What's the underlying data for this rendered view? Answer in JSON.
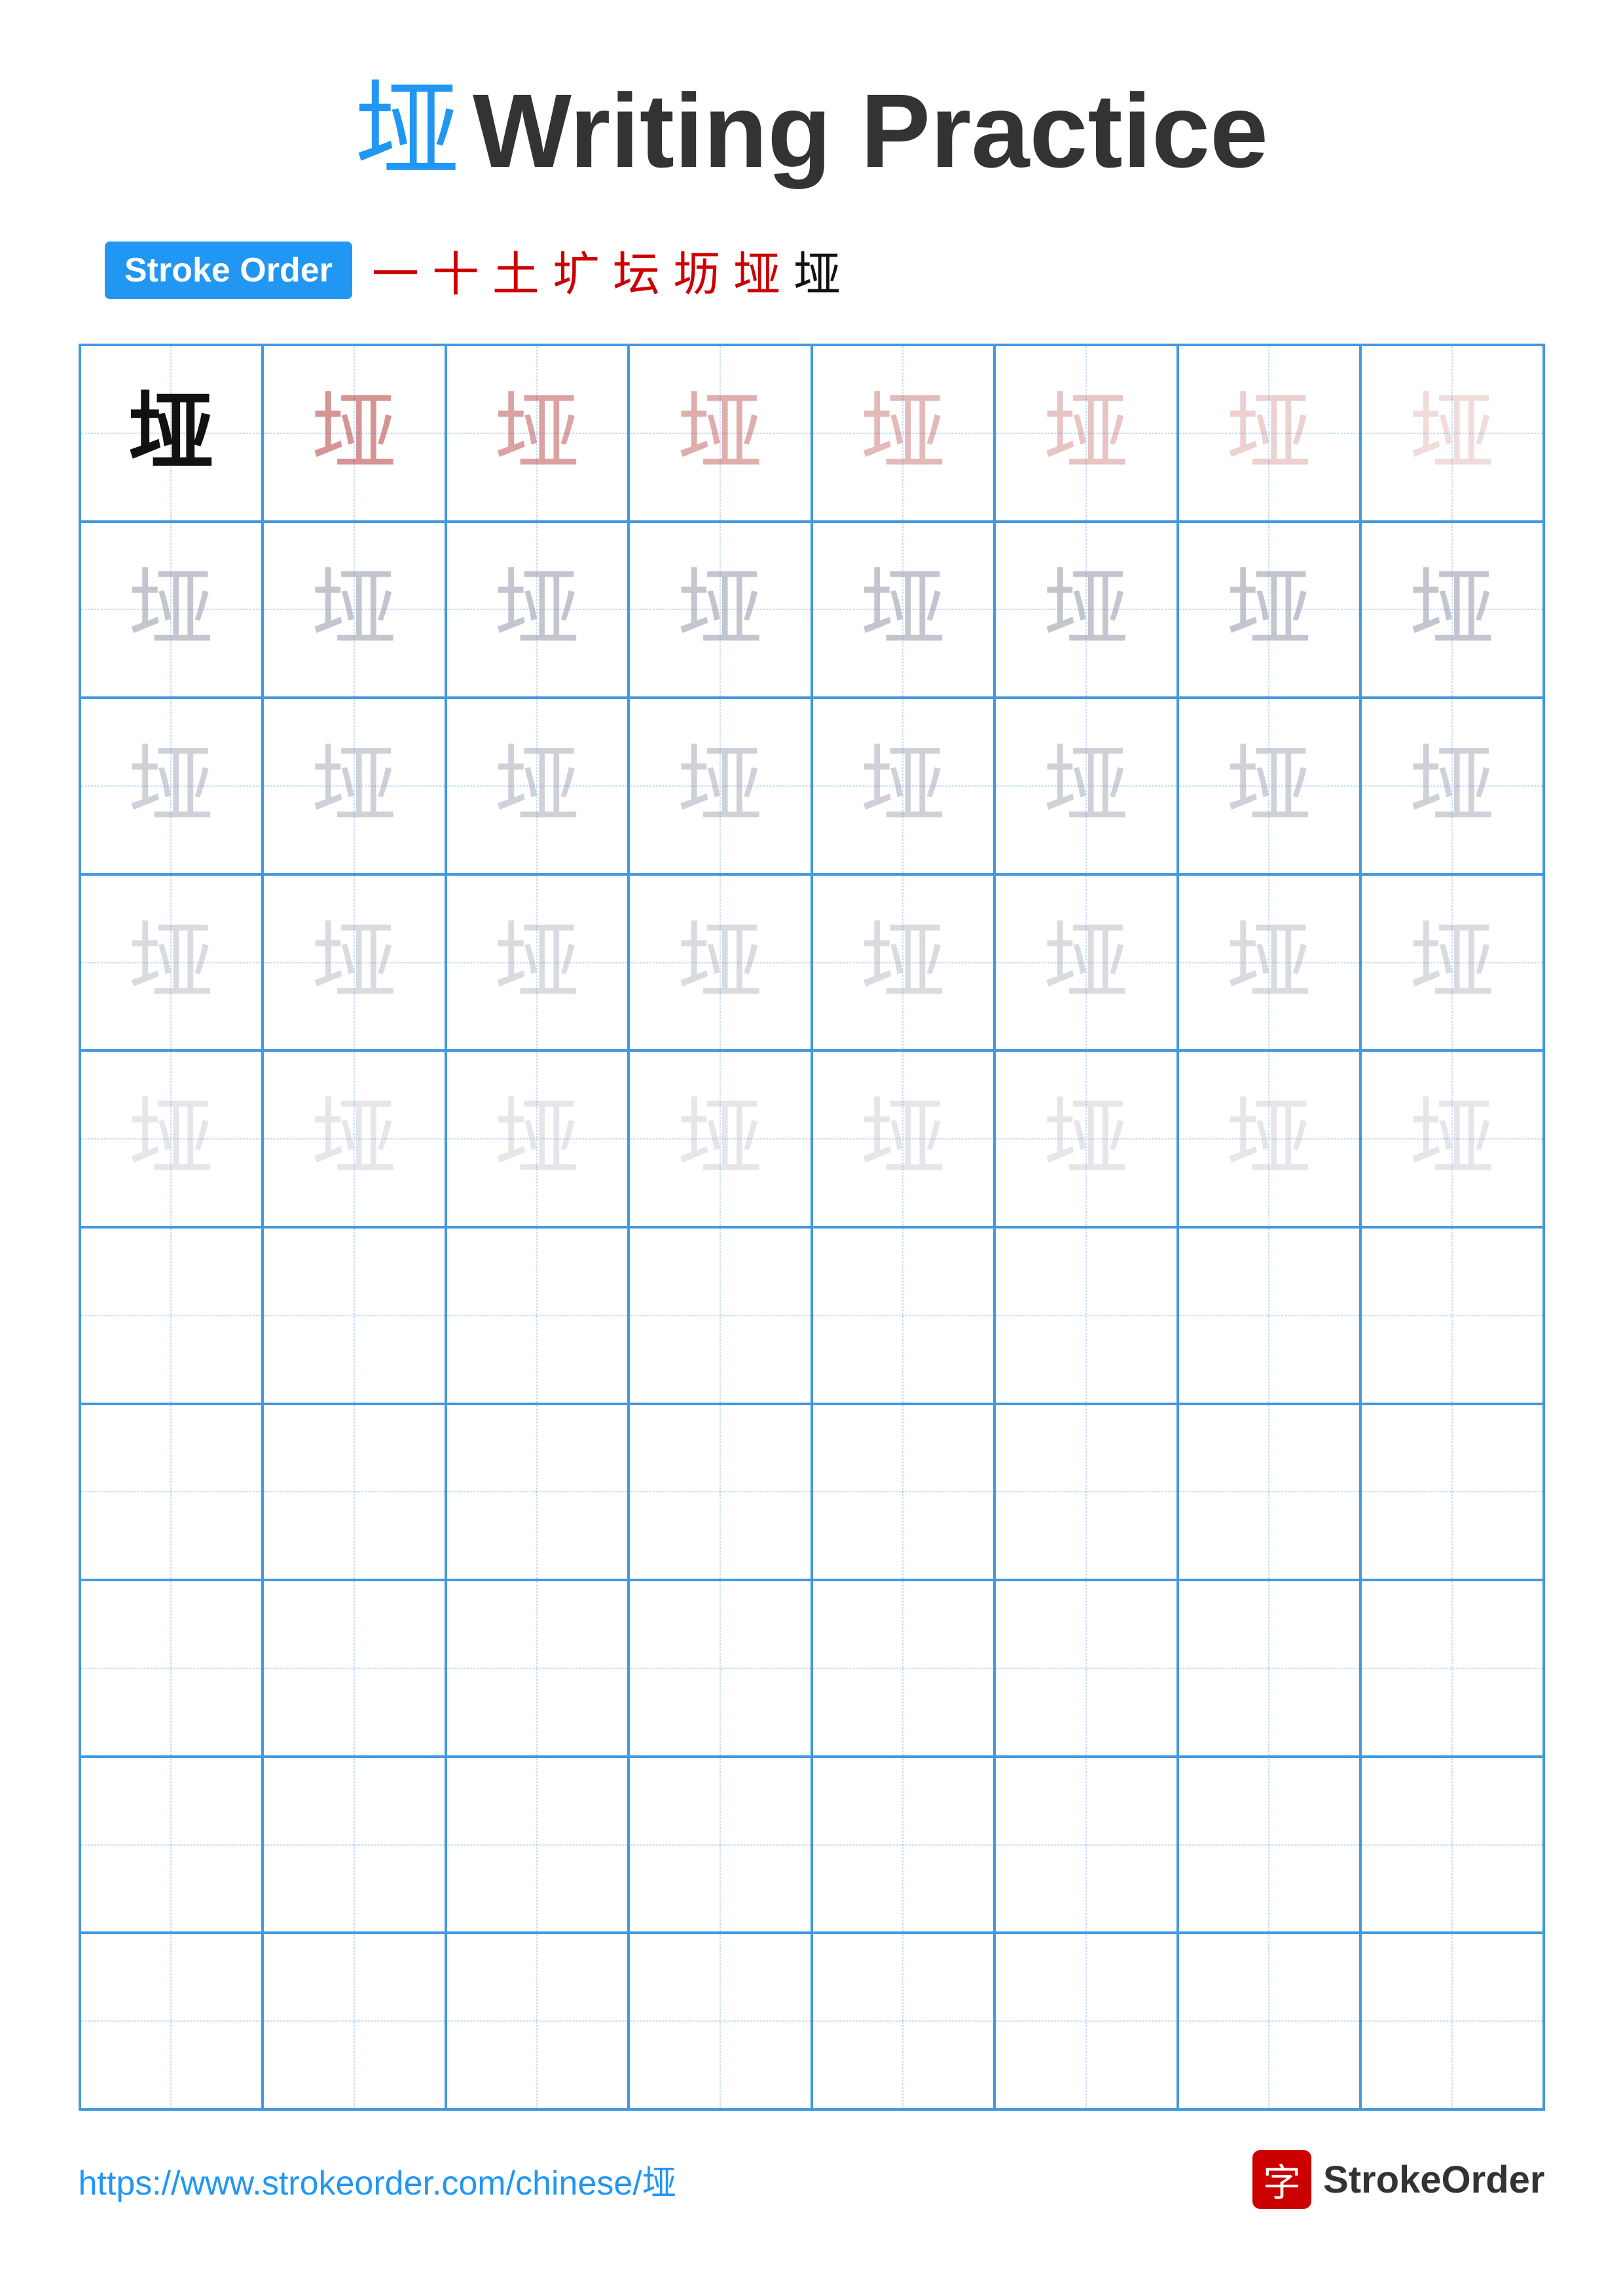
{
  "title": {
    "char": "垭",
    "text": "Writing Practice"
  },
  "stroke_order": {
    "badge_label": "Stroke Order",
    "strokes": [
      "一",
      "十",
      "土",
      "圹",
      "圹",
      "坛",
      "坜",
      "垭"
    ]
  },
  "grid": {
    "rows": 10,
    "cols": 8,
    "char": "垭"
  },
  "footer": {
    "url": "https://www.strokeorder.com/chinese/垭",
    "logo_char": "字",
    "logo_text": "StrokeOrder"
  }
}
